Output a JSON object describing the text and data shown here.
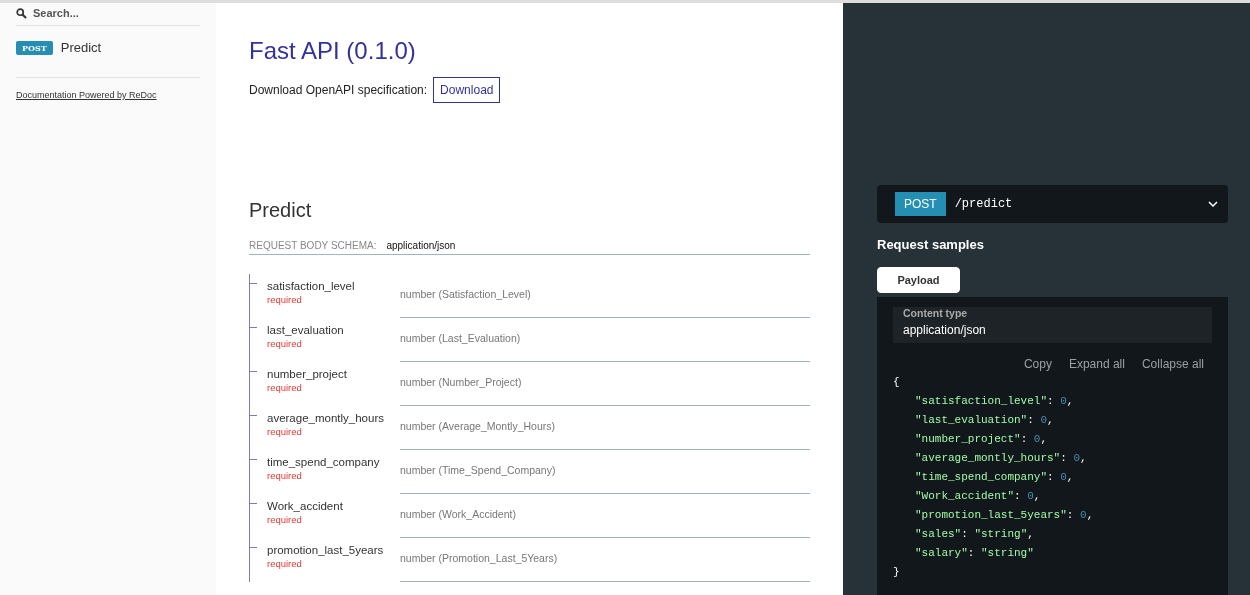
{
  "sidebar": {
    "search": {
      "placeholder": "Search..."
    },
    "items": [
      {
        "method": "POST",
        "label": "Predict",
        "selected": false
      }
    ],
    "footer_link": "Documentation Powered by ReDoc"
  },
  "api": {
    "title": "Fast API (0.1.0)",
    "download_label": "Download OpenAPI specification:",
    "download_button": "Download"
  },
  "operation": {
    "title": "Predict",
    "schema_label": "REQUEST BODY SCHEMA:",
    "schema_type": "application/json",
    "fields": [
      {
        "name": "satisfaction_level",
        "required": "required",
        "type": "number (Satisfaction_Level)"
      },
      {
        "name": "last_evaluation",
        "required": "required",
        "type": "number (Last_Evaluation)"
      },
      {
        "name": "number_project",
        "required": "required",
        "type": "number (Number_Project)"
      },
      {
        "name": "average_montly_hours",
        "required": "required",
        "type": "number (Average_Montly_Hours)"
      },
      {
        "name": "time_spend_company",
        "required": "required",
        "type": "number (Time_Spend_Company)"
      },
      {
        "name": "Work_accident",
        "required": "required",
        "type": "number (Work_Accident)"
      },
      {
        "name": "promotion_last_5years",
        "required": "required",
        "type": "number (Promotion_Last_5Years)"
      }
    ]
  },
  "panel": {
    "endpoint": {
      "method": "POST",
      "path": "/predict"
    },
    "samples_title": "Request samples",
    "tabs": [
      {
        "label": "Payload",
        "selected": true
      }
    ],
    "content_type_label": "Content type",
    "content_type": "application/json",
    "actions": [
      "Copy",
      "Expand all",
      "Collapse all"
    ],
    "code": {
      "open": "{",
      "close": "}",
      "lines": [
        {
          "key": "\"satisfaction_level\"",
          "colon": ":",
          "value": "0",
          "kind": "number",
          "comma": ","
        },
        {
          "key": "\"last_evaluation\"",
          "colon": ":",
          "value": "0",
          "kind": "number",
          "comma": ","
        },
        {
          "key": "\"number_project\"",
          "colon": ":",
          "value": "0",
          "kind": "number",
          "comma": ","
        },
        {
          "key": "\"average_montly_hours\"",
          "colon": ":",
          "value": "0",
          "kind": "number",
          "comma": ","
        },
        {
          "key": "\"time_spend_company\"",
          "colon": ":",
          "value": "0",
          "kind": "number",
          "comma": ","
        },
        {
          "key": "\"Work_accident\"",
          "colon": ":",
          "value": "0",
          "kind": "number",
          "comma": ","
        },
        {
          "key": "\"promotion_last_5years\"",
          "colon": ":",
          "value": "0",
          "kind": "number",
          "comma": ","
        },
        {
          "key": "\"sales\"",
          "colon": ":",
          "value": "\"string\"",
          "kind": "string",
          "comma": ","
        },
        {
          "key": "\"salary\"",
          "colon": ":",
          "value": "\"string\"",
          "kind": "string"
        }
      ]
    }
  }
}
